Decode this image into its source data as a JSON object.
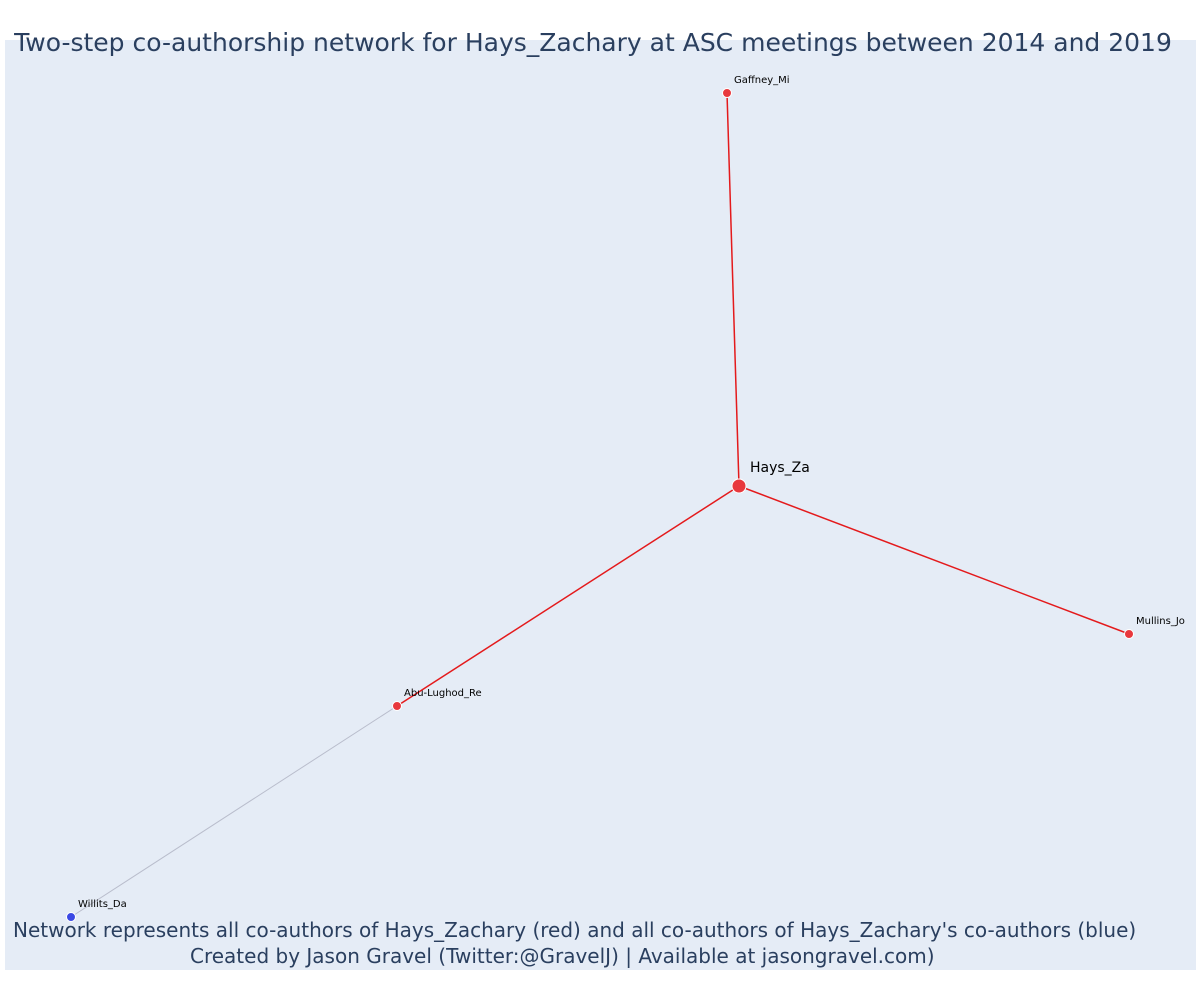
{
  "title": "Two-step co-authorship network for Hays_Zachary at ASC meetings between 2014 and 2019",
  "caption": {
    "line1": "Network represents all co-authors of Hays_Zachary (red) and all co-authors of Hays_Zachary's co-authors (blue)",
    "line2": "Created by Jason Gravel (Twitter:@GravelJ) | Available at jasongravel.com)"
  },
  "colors": {
    "background": "#e5ecf6",
    "first_degree": "#e8383d",
    "second_degree": "#3b49e4",
    "first_degree_edge": "#e41a1c",
    "second_degree_edge": "#b9bdcc",
    "text": "#2a3f5f"
  },
  "nodes": [
    {
      "id": "Hays_Za",
      "label": "Hays_Za",
      "group": "ego"
    },
    {
      "id": "Gaffney_Mi",
      "label": "Gaffney_Mi",
      "group": "first_degree"
    },
    {
      "id": "Mullins_Jo",
      "label": "Mullins_Jo",
      "group": "first_degree"
    },
    {
      "id": "Abu-Lughod_Re",
      "label": "Abu-Lughod_Re",
      "group": "first_degree"
    },
    {
      "id": "Willits_Da",
      "label": "Willits_Da",
      "group": "second_degree"
    }
  ],
  "edges": [
    {
      "source": "Hays_Za",
      "target": "Gaffney_Mi",
      "type": "first_degree"
    },
    {
      "source": "Hays_Za",
      "target": "Mullins_Jo",
      "type": "first_degree"
    },
    {
      "source": "Hays_Za",
      "target": "Abu-Lughod_Re",
      "type": "first_degree"
    },
    {
      "source": "Abu-Lughod_Re",
      "target": "Willits_Da",
      "type": "second_degree"
    }
  ]
}
